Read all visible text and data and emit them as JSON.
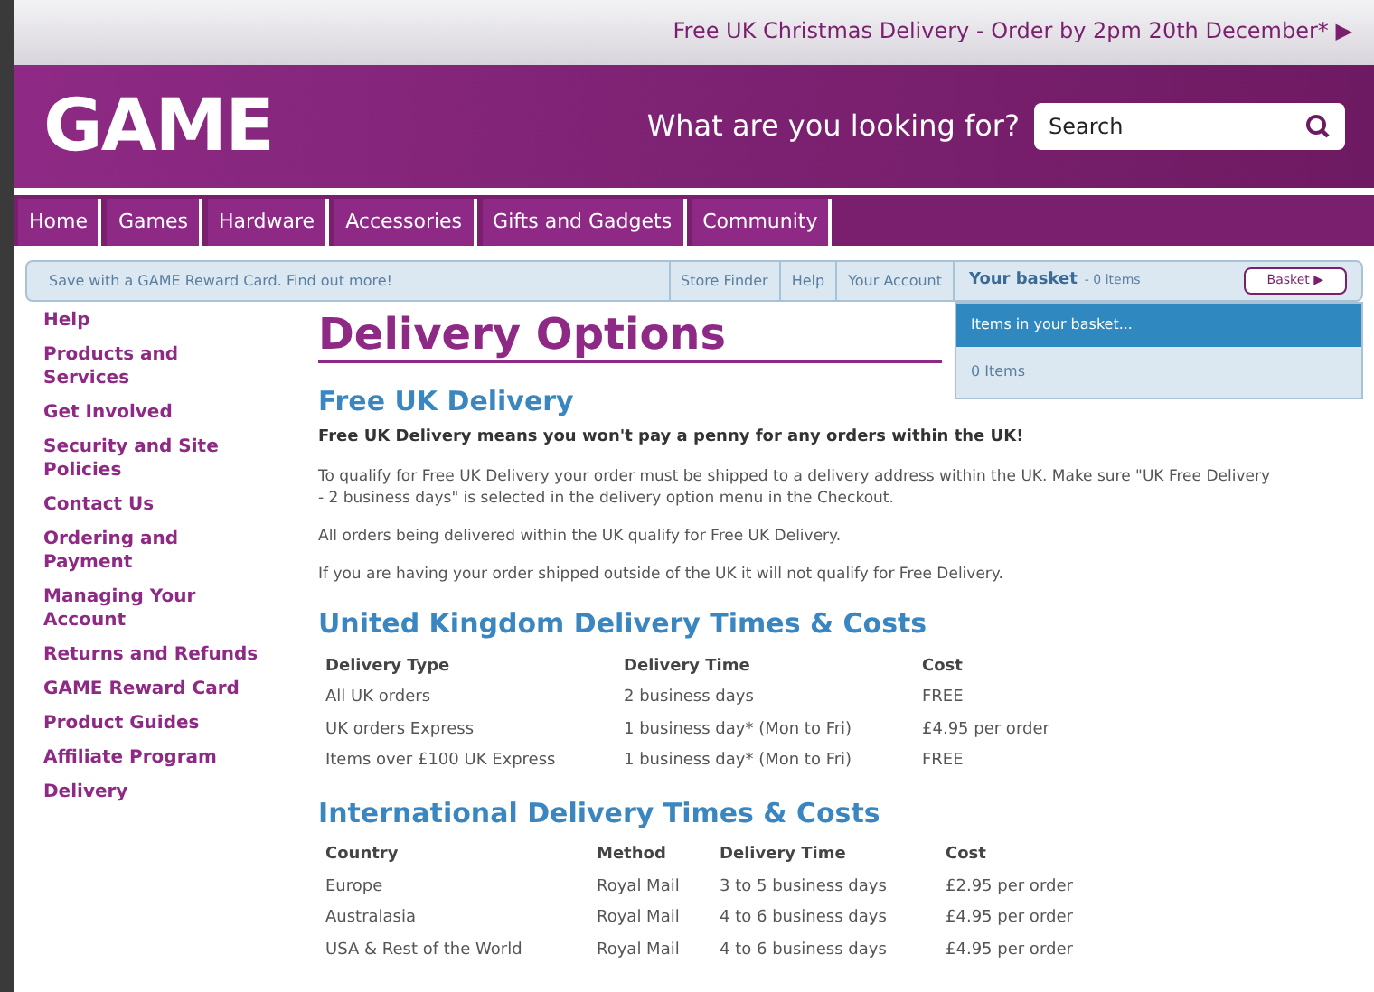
{
  "promo": {
    "text": "Free UK Christmas Delivery - Order by 2pm 20th December*",
    "arrow": "▶"
  },
  "logo": "GAME",
  "search": {
    "prompt": "What are you looking for?",
    "placeholder": "Search"
  },
  "nav": [
    "Home",
    "Games",
    "Hardware",
    "Accessories",
    "Gifts and Gadgets",
    "Community"
  ],
  "info_bar": {
    "reward": "Save with a GAME Reward Card. Find out more!",
    "links": [
      "Store Finder",
      "Help",
      "Your Account"
    ],
    "basket_label": "Your basket",
    "basket_count": "- 0 items",
    "basket_button": "Basket ▶"
  },
  "basket_menu": {
    "header": "Items in your basket...",
    "count": "0 Items"
  },
  "sidebar": [
    "Help",
    "Products and Services",
    "Get Involved",
    "Security and Site Policies",
    "Contact Us",
    "Ordering and Payment",
    "Managing Your Account",
    "Returns and Refunds",
    "GAME Reward Card",
    "Product Guides",
    "Affiliate Program",
    "Delivery"
  ],
  "page_title": "Delivery Options",
  "free_uk": {
    "heading": "Free UK Delivery",
    "lead": "Free UK Delivery means you won't pay a penny for any orders within the UK!",
    "paragraphs": [
      "To qualify for Free UK Delivery your order must be shipped to a delivery address within the UK. Make sure \"UK Free Delivery - 2 business days\" is selected in the delivery option menu in the Checkout.",
      "All orders being delivered within the UK qualify for Free UK Delivery.",
      "If you are having your order shipped outside of the UK it will not qualify for Free Delivery."
    ]
  },
  "uk_table": {
    "heading": "United Kingdom Delivery Times & Costs",
    "columns": [
      "Delivery Type",
      "Delivery Time",
      "Cost"
    ],
    "rows": [
      [
        "All UK orders",
        "2 business days",
        "FREE"
      ],
      [
        "UK orders Express",
        "1 business day* (Mon to Fri)",
        "£4.95 per order"
      ],
      [
        "Items over £100 UK Express",
        "1 business day* (Mon to Fri)",
        "FREE"
      ]
    ]
  },
  "intl_table": {
    "heading": "International Delivery Times & Costs",
    "columns": [
      "Country",
      "Method",
      "Delivery Time",
      "Cost"
    ],
    "rows": [
      [
        "Europe",
        "Royal Mail",
        "3 to 5 business days",
        "£2.95 per order"
      ],
      [
        "Australasia",
        "Royal Mail",
        "4 to 6 business days",
        "£4.95 per order"
      ],
      [
        "USA & Rest of the World",
        "Royal Mail",
        "4 to 6 business days",
        "£4.95 per order"
      ]
    ]
  }
}
